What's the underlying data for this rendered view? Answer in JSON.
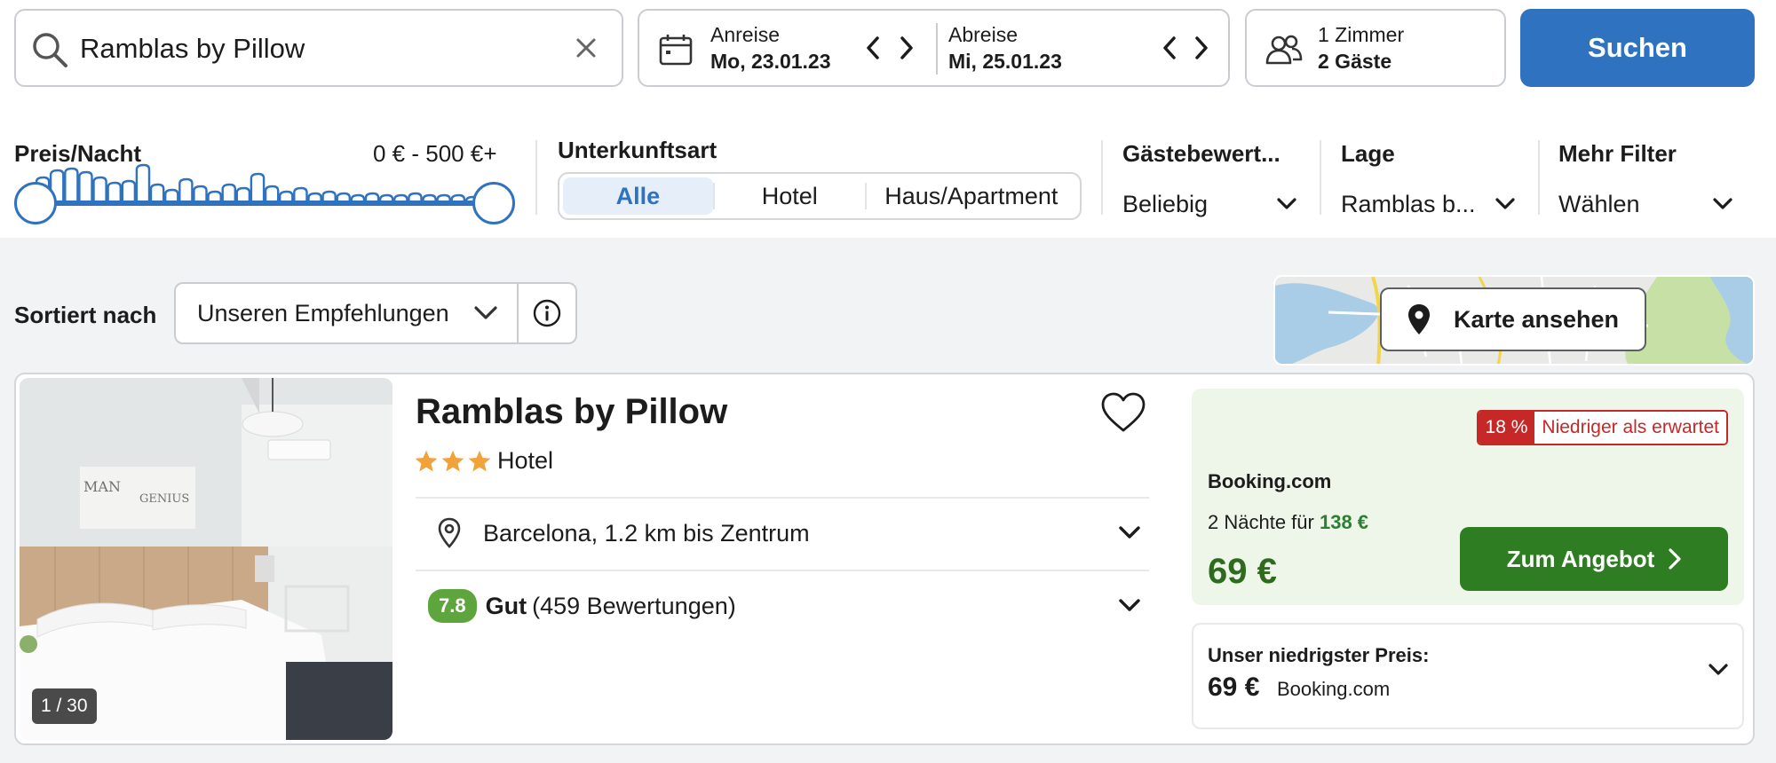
{
  "search": {
    "query": "Ramblas by Pillow",
    "button_label": "Suchen"
  },
  "dates": {
    "checkin_label": "Anreise",
    "checkin_value": "Mo, 23.01.23",
    "checkout_label": "Abreise",
    "checkout_value": "Mi, 25.01.23"
  },
  "guests": {
    "rooms": "1 Zimmer",
    "guests": "2 Gäste"
  },
  "filters": {
    "price_label": "Preis/Nacht",
    "price_range": "0 € - 500 €+",
    "price_min": 0,
    "price_max": 500,
    "accommodation_label": "Unterkunftsart",
    "accommodation_options": [
      "Alle",
      "Hotel",
      "Haus/Apartment"
    ],
    "accommodation_selected": "Alle",
    "rating_label": "Gästebewert...",
    "rating_value": "Beliebig",
    "location_label": "Lage",
    "location_value": "Ramblas b...",
    "more_label": "Mehr Filter",
    "more_value": "Wählen"
  },
  "sort": {
    "label": "Sortiert nach",
    "value": "Unseren Empfehlungen"
  },
  "map": {
    "button_label": "Karte ansehen"
  },
  "hotel": {
    "name": "Ramblas by Pillow",
    "stars": 3,
    "type": "Hotel",
    "location": "Barcelona, 1.2 km bis Zentrum",
    "rating_score": "7.8",
    "rating_word": "Gut",
    "rating_count": "(459 Bewertungen)",
    "photo_counter": "1 / 30",
    "deal": {
      "discount_pct": "18 %",
      "discount_text": "Niedriger als erwartet",
      "provider": "Booking.com",
      "nights_text": "2 Nächte für",
      "nights_price": "138 €",
      "price": "69 €",
      "button_label": "Zum Angebot"
    },
    "lowest": {
      "label": "Unser niedrigster Preis:",
      "price": "69 €",
      "provider": "Booking.com"
    }
  },
  "colors": {
    "primary": "#2f72c0",
    "deal_green": "#2e7d22",
    "rating_green": "#5fa53e",
    "alert_red": "#c62828",
    "star_orange": "#f2a23a"
  }
}
